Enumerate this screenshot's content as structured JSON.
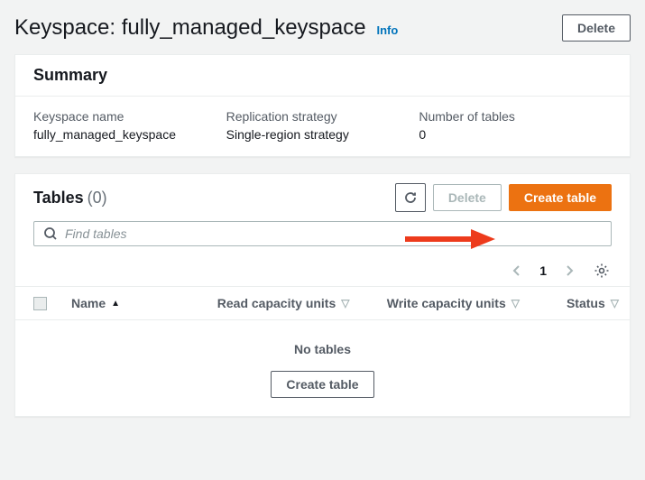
{
  "header": {
    "title_prefix": "Keyspace: ",
    "keyspace_name": "fully_managed_keyspace",
    "info_label": "Info",
    "delete_label": "Delete"
  },
  "summary": {
    "panel_title": "Summary",
    "keyspace_name_label": "Keyspace name",
    "keyspace_name_value": "fully_managed_keyspace",
    "replication_label": "Replication strategy",
    "replication_value": "Single-region strategy",
    "num_tables_label": "Number of tables",
    "num_tables_value": "0"
  },
  "tables": {
    "title": "Tables",
    "count": "(0)",
    "refresh_label": "Refresh",
    "delete_label": "Delete",
    "create_label": "Create table",
    "search_placeholder": "Find tables",
    "page": "1",
    "columns": {
      "name": "Name",
      "read_capacity": "Read capacity units",
      "write_capacity": "Write capacity units",
      "status": "Status"
    },
    "empty_message": "No tables",
    "empty_create_label": "Create table"
  }
}
